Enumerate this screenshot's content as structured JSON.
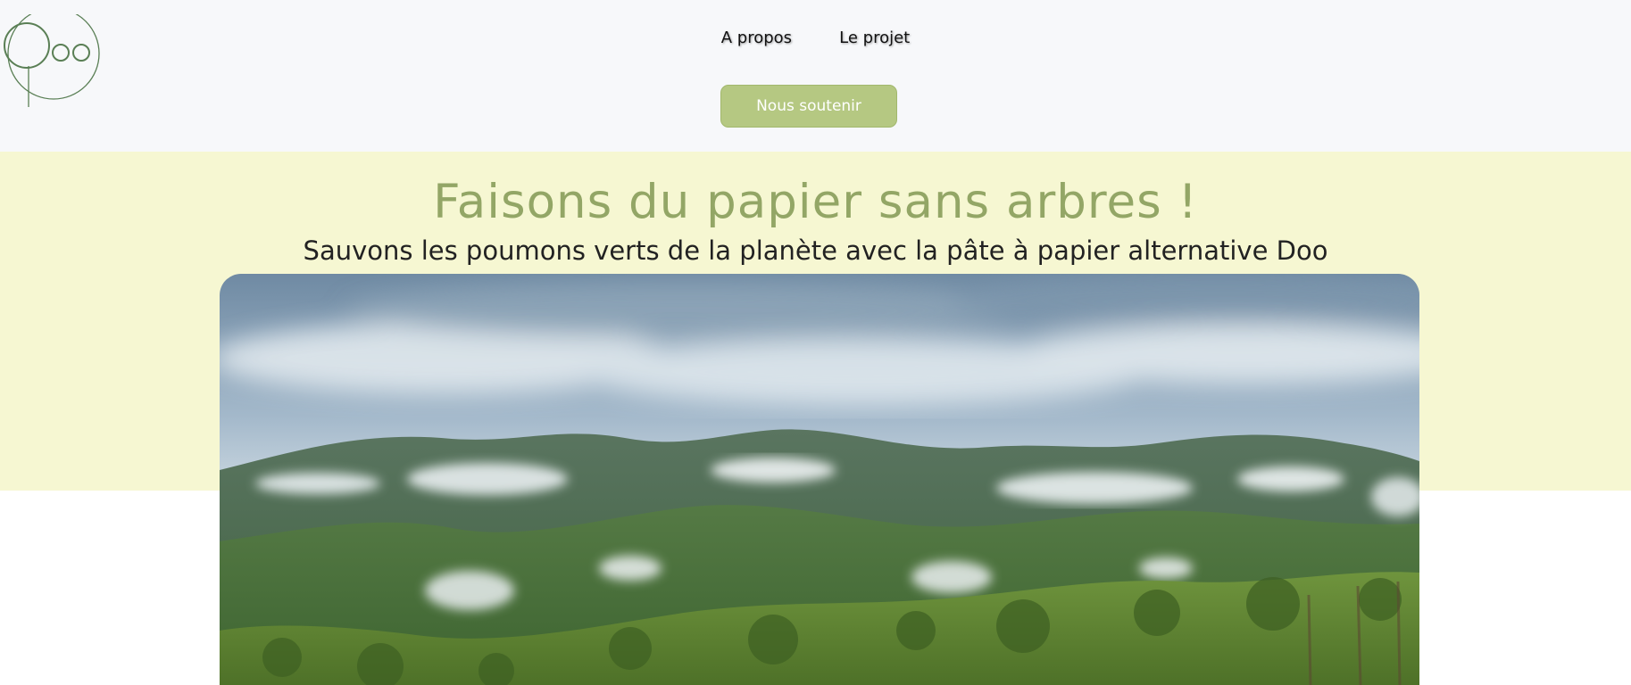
{
  "header": {
    "logo": {
      "text": "Doo",
      "icon": "doo-tree-logo"
    },
    "nav": [
      {
        "label": "A propos"
      },
      {
        "label": "Le projet"
      }
    ],
    "cta_label": "Nous soutenir"
  },
  "hero": {
    "title": "Faisons du papier sans arbres !",
    "subtitle": "Sauvons les poumons verts de la planète avec la pâte à papier alternative Doo",
    "image": {
      "subject": "misty forested mountains"
    }
  },
  "colors": {
    "header_bg": "#f7f8fa",
    "hero_band": "#f6f7d2",
    "accent_green": "#93a666",
    "button_green": "#b5c882",
    "logo_stroke": "#5a7f55"
  }
}
